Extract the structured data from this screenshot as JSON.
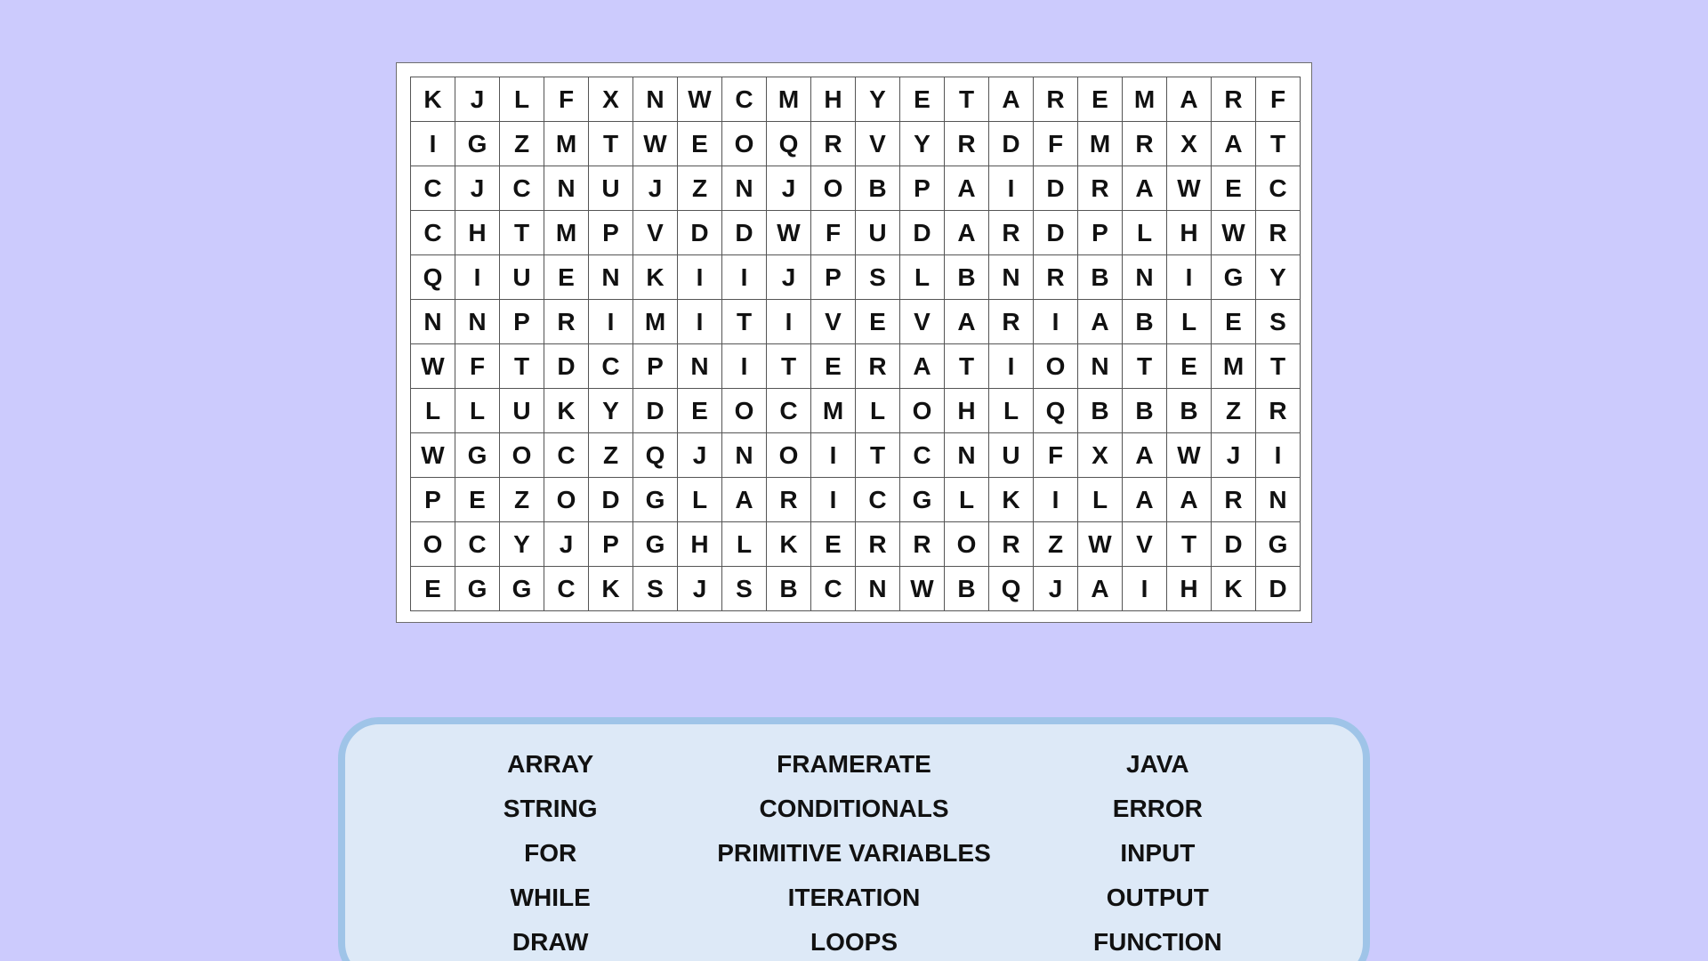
{
  "puzzle": {
    "grid": [
      [
        "K",
        "J",
        "L",
        "F",
        "X",
        "N",
        "W",
        "C",
        "M",
        "H",
        "Y",
        "E",
        "T",
        "A",
        "R",
        "E",
        "M",
        "A",
        "R",
        "F"
      ],
      [
        "I",
        "G",
        "Z",
        "M",
        "T",
        "W",
        "E",
        "O",
        "Q",
        "R",
        "V",
        "Y",
        "R",
        "D",
        "F",
        "M",
        "R",
        "X",
        "A",
        "T"
      ],
      [
        "C",
        "J",
        "C",
        "N",
        "U",
        "J",
        "Z",
        "N",
        "J",
        "O",
        "B",
        "P",
        "A",
        "I",
        "D",
        "R",
        "A",
        "W",
        "E",
        "C"
      ],
      [
        "C",
        "H",
        "T",
        "M",
        "P",
        "V",
        "D",
        "D",
        "W",
        "F",
        "U",
        "D",
        "A",
        "R",
        "D",
        "P",
        "L",
        "H",
        "W",
        "R"
      ],
      [
        "Q",
        "I",
        "U",
        "E",
        "N",
        "K",
        "I",
        "I",
        "J",
        "P",
        "S",
        "L",
        "B",
        "N",
        "R",
        "B",
        "N",
        "I",
        "G",
        "Y"
      ],
      [
        "N",
        "N",
        "P",
        "R",
        "I",
        "M",
        "I",
        "T",
        "I",
        "V",
        "E",
        "V",
        "A",
        "R",
        "I",
        "A",
        "B",
        "L",
        "E",
        "S"
      ],
      [
        "W",
        "F",
        "T",
        "D",
        "C",
        "P",
        "N",
        "I",
        "T",
        "E",
        "R",
        "A",
        "T",
        "I",
        "O",
        "N",
        "T",
        "E",
        "M",
        "T"
      ],
      [
        "L",
        "L",
        "U",
        "K",
        "Y",
        "D",
        "E",
        "O",
        "C",
        "M",
        "L",
        "O",
        "H",
        "L",
        "Q",
        "B",
        "B",
        "B",
        "Z",
        "R"
      ],
      [
        "W",
        "G",
        "O",
        "C",
        "Z",
        "Q",
        "J",
        "N",
        "O",
        "I",
        "T",
        "C",
        "N",
        "U",
        "F",
        "X",
        "A",
        "W",
        "J",
        "I"
      ],
      [
        "P",
        "E",
        "Z",
        "O",
        "D",
        "G",
        "L",
        "A",
        "R",
        "I",
        "C",
        "G",
        "L",
        "K",
        "I",
        "L",
        "A",
        "A",
        "R",
        "N"
      ],
      [
        "O",
        "C",
        "Y",
        "J",
        "P",
        "G",
        "H",
        "L",
        "K",
        "E",
        "R",
        "R",
        "O",
        "R",
        "Z",
        "W",
        "V",
        "T",
        "D",
        "G"
      ],
      [
        "E",
        "G",
        "G",
        "C",
        "K",
        "S",
        "J",
        "S",
        "B",
        "C",
        "N",
        "W",
        "B",
        "Q",
        "J",
        "A",
        "I",
        "H",
        "K",
        "D"
      ]
    ]
  },
  "words": {
    "columns": [
      [
        "ARRAY",
        "STRING",
        "FOR",
        "WHILE",
        "DRAW"
      ],
      [
        "FRAMERATE",
        "CONDITIONALS",
        "PRIMITIVE VARIABLES",
        "ITERATION",
        "LOOPS"
      ],
      [
        "JAVA",
        "ERROR",
        "INPUT",
        "OUTPUT",
        "FUNCTION"
      ]
    ]
  }
}
